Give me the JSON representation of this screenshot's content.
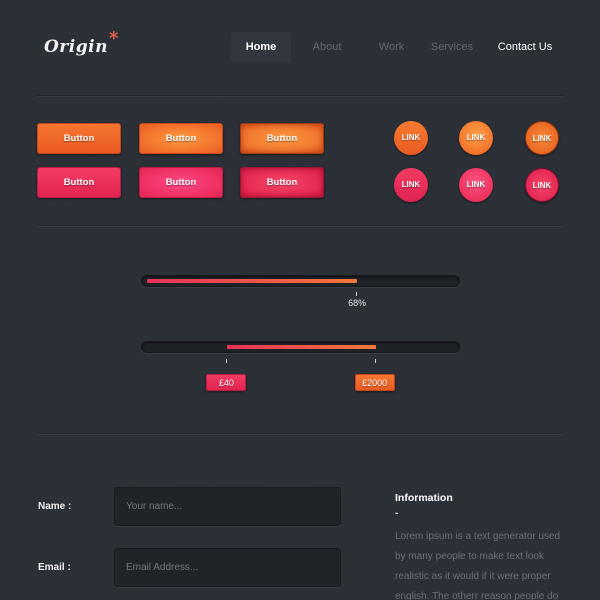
{
  "header": {
    "logo": "Origin",
    "logo_mark": "*",
    "nav": [
      {
        "label": "Home",
        "state": "active"
      },
      {
        "label": "About",
        "state": "normal"
      },
      {
        "label": "Work",
        "state": "normal"
      },
      {
        "label": "Services",
        "state": "normal"
      },
      {
        "label": "Contact Us",
        "state": "highlight"
      }
    ]
  },
  "buttons": {
    "orange": [
      "Button",
      "Button",
      "Button"
    ],
    "pink": [
      "Button",
      "Button",
      "Button"
    ]
  },
  "links": {
    "orange": [
      "LINK",
      "LINK",
      "LINK"
    ],
    "pink": [
      "LINK",
      "LINK",
      "LINK"
    ]
  },
  "progress": {
    "value": 68,
    "label": "68%"
  },
  "range_slider": {
    "low_fraction": 0.26,
    "high_fraction": 0.74,
    "low_label": "£40",
    "high_label": "£2000"
  },
  "form": {
    "name_label": "Name :",
    "name_placeholder": "Your name...",
    "name_value": "",
    "email_label": "Email :",
    "email_placeholder": "Email Address...",
    "email_value": ""
  },
  "info": {
    "title": "Information",
    "dash": "-",
    "body": "Lorem ipsum is a text generator used by many people to make text look realistic as it would if it were proper english.  The otherr reason people do"
  },
  "colors": {
    "background": "#2b2f36",
    "accent_orange": "#f26b2a",
    "accent_pink": "#e8315a",
    "logo_star": "#f4634e"
  }
}
